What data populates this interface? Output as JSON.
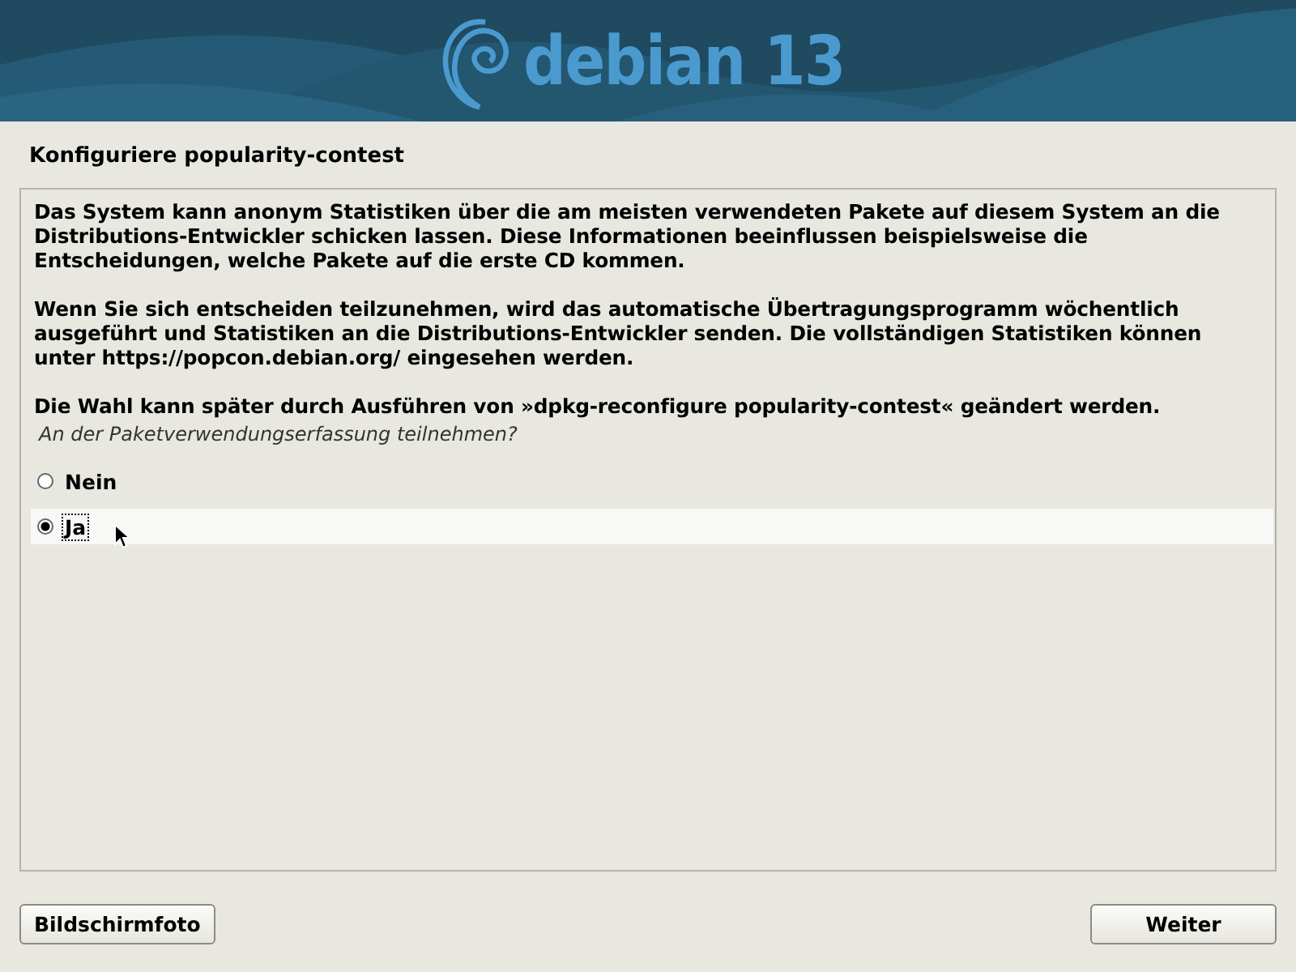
{
  "banner": {
    "logo_text": "debian 13"
  },
  "title": "Konfiguriere popularity-contest",
  "paragraphs": [
    "Das System kann anonym Statistiken über die am meisten verwendeten Pakete auf diesem System an die\nDistributions-Entwickler schicken lassen. Diese Informationen beeinflussen beispielsweise die\nEntscheidungen, welche Pakete auf die erste CD kommen.",
    "Wenn Sie sich entscheiden teilzunehmen, wird das automatische Übertragungsprogramm wöchentlich\nausgeführt und Statistiken an die Distributions-Entwickler senden. Die vollständigen Statistiken können\nunter https://popcon.debian.org/ eingesehen werden.",
    "Die Wahl kann später durch Ausführen von »dpkg-reconfigure popularity-contest« geändert werden."
  ],
  "question": "An der Paketverwendungserfassung teilnehmen?",
  "options": [
    {
      "label": "Nein",
      "selected": false
    },
    {
      "label": "Ja",
      "selected": true
    }
  ],
  "buttons": {
    "left": "Bildschirmfoto",
    "right": "Weiter"
  }
}
